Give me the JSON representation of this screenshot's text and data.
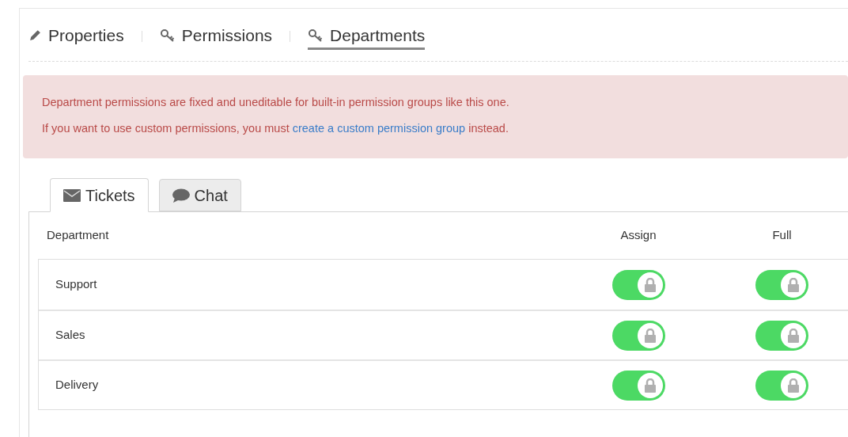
{
  "section_tabs": [
    {
      "label": "Properties",
      "selected": false
    },
    {
      "label": "Permissions",
      "selected": false
    },
    {
      "label": "Departments",
      "selected": true
    }
  ],
  "alert": {
    "line_1": "Department permissions are fixed and uneditable for built-in permission groups like this one.",
    "line_2_before": "If you want to use custom permissions, you must",
    "link": "create a custom permission group",
    "line_2_after": "instead."
  },
  "channel_tabs": [
    {
      "label": "Tickets",
      "selected": true
    },
    {
      "label": "Chat",
      "selected": false
    }
  ],
  "table": {
    "columns": [
      "Department",
      "Assign",
      "Full"
    ],
    "rows": [
      {
        "name": "Support",
        "assign": {
          "on": true,
          "locked": true
        },
        "full": {
          "on": true,
          "locked": true
        }
      },
      {
        "name": "Sales",
        "assign": {
          "on": true,
          "locked": true
        },
        "full": {
          "on": true,
          "locked": true
        }
      },
      {
        "name": "Delivery",
        "assign": {
          "on": true,
          "locked": true
        },
        "full": {
          "on": true,
          "locked": true
        }
      }
    ]
  }
}
